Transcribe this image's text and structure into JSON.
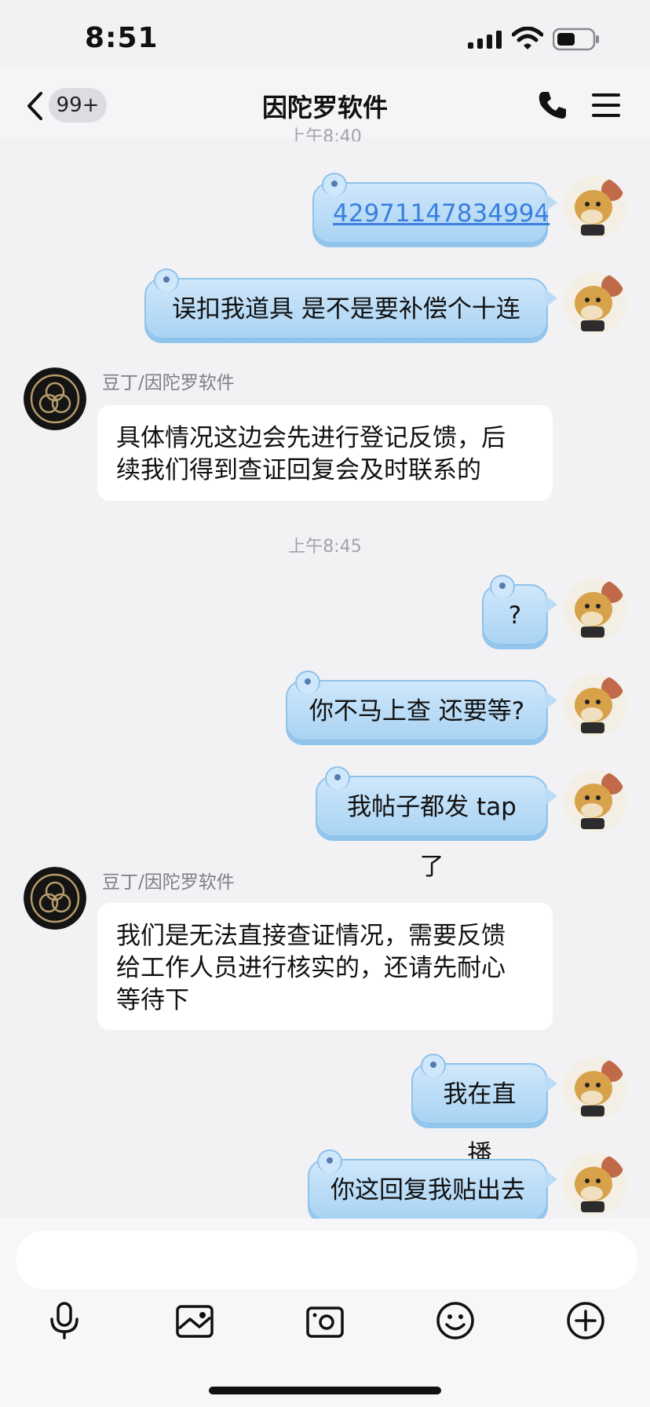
{
  "status_bar": {
    "time": "8:51"
  },
  "header": {
    "unread_count": "99+",
    "title": "因陀罗软件"
  },
  "messages": {
    "partial_timestamp": "上午8:40",
    "m1": "42971147834994",
    "m2": "误扣我道具 是不是要补偿个十连",
    "r1": {
      "sender": "豆丁/因陀罗软件",
      "lines": [
        "具体情况这边会先进行登记反馈，后",
        "续我们得到查证回复会及时联系的"
      ]
    },
    "timestamp2": "上午8:45",
    "m3": "?",
    "m4": "你不马上查 还要等?",
    "m5": "我帖子都发 tap 了",
    "r2": {
      "sender": "豆丁/因陀罗软件",
      "lines": [
        "我们是无法直接查证情况，需要反馈",
        "给工作人员进行核实的，还请先耐心",
        "等待下"
      ]
    },
    "m6": "我在直播",
    "m7": "你这回复我贴出去"
  },
  "colors": {
    "outgoing_bubble": "#a9d3f3",
    "link": "#3a7fdf",
    "background": "#f2f2f5"
  },
  "toolbar_icons": [
    "microphone-icon",
    "image-icon",
    "camera-icon",
    "emoji-icon",
    "plus-icon"
  ]
}
